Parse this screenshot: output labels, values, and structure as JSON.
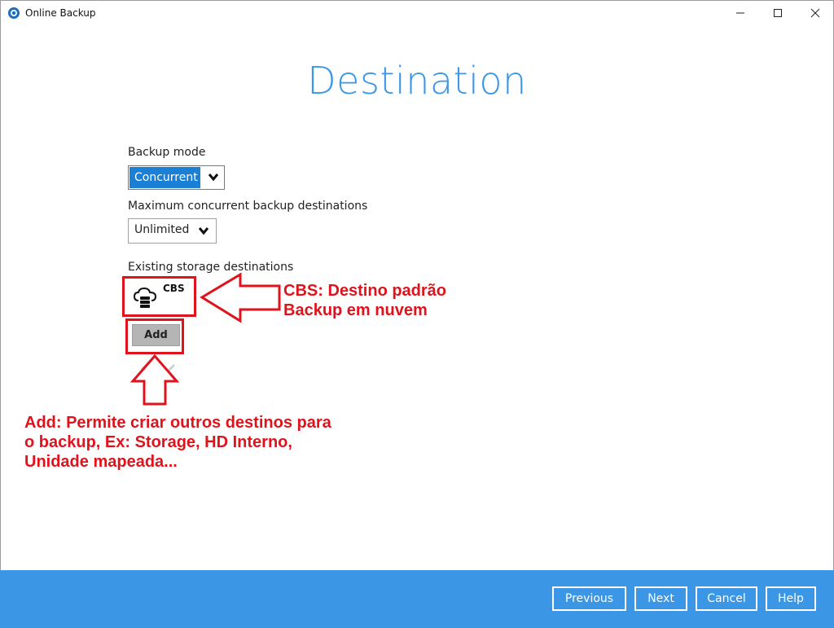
{
  "window": {
    "title": "Online Backup",
    "controls": [
      "minimize-icon",
      "maximize-icon",
      "close-icon"
    ]
  },
  "page": {
    "heading": "Destination"
  },
  "form": {
    "backup_mode_label": "Backup mode",
    "backup_mode_value": "Concurrent",
    "max_concurrent_label": "Maximum concurrent backup destinations",
    "max_concurrent_value": "Unlimited",
    "existing_label": "Existing storage destinations",
    "destinations": [
      {
        "name": "CBS",
        "icon": "cloud-storage-icon"
      }
    ],
    "add_label": "Add"
  },
  "annotations": {
    "cbs_line1": "CBS: Destino padrão",
    "cbs_line2": "Backup em nuvem",
    "add_line1": "Add: Permite criar outros destinos para",
    "add_line2": "o backup, Ex: Storage, HD Interno,",
    "add_line3": "Unidade mapeada...",
    "color": "#e0121c"
  },
  "footer": {
    "previous_label": "Previous",
    "next_label": "Next",
    "cancel_label": "Cancel",
    "help_label": "Help"
  },
  "colors": {
    "accent": "#3a96e8",
    "footer_bg": "#3b96e6",
    "select_highlight": "#1b7fd6"
  }
}
